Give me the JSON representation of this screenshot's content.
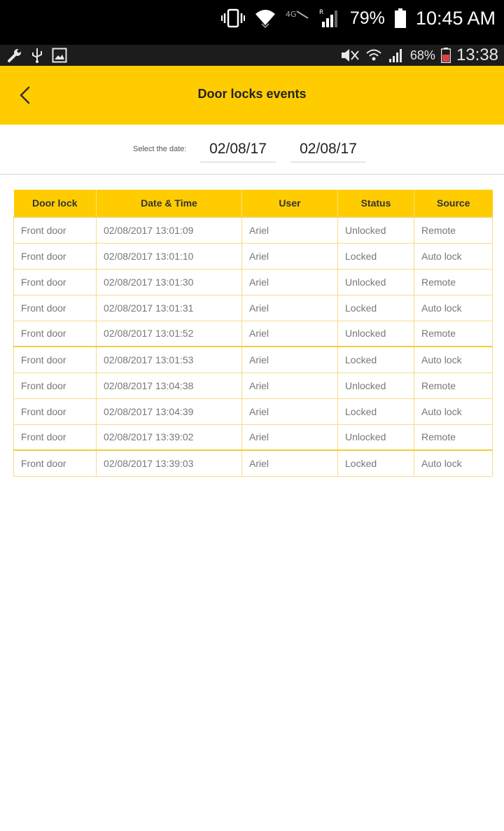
{
  "outer_status": {
    "battery_pct": "79%",
    "time": "10:45 AM"
  },
  "inner_status": {
    "battery_pct": "68%",
    "time": "13:38"
  },
  "header": {
    "title": "Door locks events"
  },
  "date_filter": {
    "label": "Select the date:",
    "from": "02/08/17",
    "to": "02/08/17"
  },
  "table": {
    "columns": [
      "Door lock",
      "Date & Time",
      "User",
      "Status",
      "Source"
    ],
    "rows": [
      [
        "Front door",
        "02/08/2017 13:01:09",
        "Ariel",
        "Unlocked",
        "Remote"
      ],
      [
        "Front door",
        "02/08/2017 13:01:10",
        "Ariel",
        "Locked",
        "Auto lock"
      ],
      [
        "Front door",
        "02/08/2017 13:01:30",
        "Ariel",
        "Unlocked",
        "Remote"
      ],
      [
        "Front door",
        "02/08/2017 13:01:31",
        "Ariel",
        "Locked",
        "Auto lock"
      ],
      [
        "Front door",
        "02/08/2017 13:01:52",
        "Ariel",
        "Unlocked",
        "Remote"
      ],
      [
        "Front door",
        "02/08/2017 13:01:53",
        "Ariel",
        "Locked",
        "Auto lock"
      ],
      [
        "Front door",
        "02/08/2017 13:04:38",
        "Ariel",
        "Unlocked",
        "Remote"
      ],
      [
        "Front door",
        "02/08/2017 13:04:39",
        "Ariel",
        "Locked",
        "Auto lock"
      ],
      [
        "Front door",
        "02/08/2017 13:39:02",
        "Ariel",
        "Unlocked",
        "Remote"
      ],
      [
        "Front door",
        "02/08/2017 13:39:03",
        "Ariel",
        "Locked",
        "Auto lock"
      ]
    ]
  },
  "icons": {
    "outer": [
      "vibrate-icon",
      "wifi-icon",
      "mobile-data-icon",
      "signal-icon",
      "battery-icon"
    ],
    "inner": [
      "wrench-icon",
      "usb-icon",
      "image-icon",
      "mute-icon",
      "wifi-icon",
      "signal-icon",
      "battery-icon"
    ],
    "back": "back-arrow-icon"
  },
  "colors": {
    "accent": "#ffcc00",
    "status_bar": "#000000",
    "text_muted": "#777777"
  }
}
